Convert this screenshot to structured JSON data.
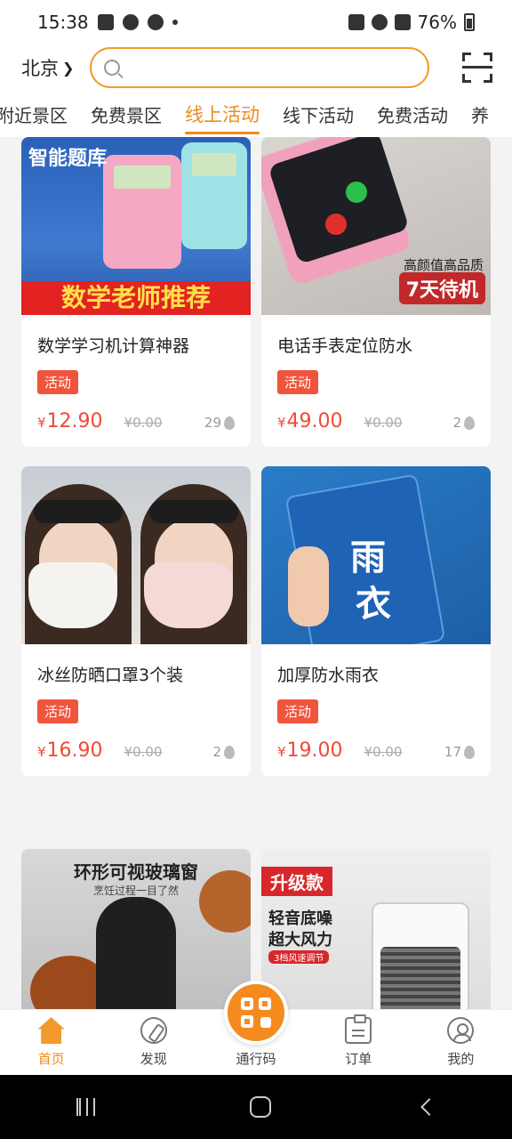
{
  "status_bar": {
    "time": "15:38",
    "battery": "76%"
  },
  "header": {
    "city": "北京",
    "search": {
      "placeholder": "",
      "value": ""
    }
  },
  "tabs": [
    {
      "label": "附近景区",
      "active": false
    },
    {
      "label": "免费景区",
      "active": false
    },
    {
      "label": "线上活动",
      "active": true
    },
    {
      "label": "线下活动",
      "active": false
    },
    {
      "label": "免费活动",
      "active": false
    },
    {
      "label": "养",
      "active": false
    }
  ],
  "products": [
    {
      "name": "数学学习机计算神器",
      "tag": "活动",
      "currency": "¥",
      "price": "12.90",
      "old_price": "¥0.00",
      "hot": "29",
      "image": {
        "title": "智能题库",
        "banner": "数学老师推荐"
      }
    },
    {
      "name": "电话手表定位防水",
      "tag": "活动",
      "currency": "¥",
      "price": "49.00",
      "old_price": "¥0.00",
      "hot": "2",
      "image": {
        "caption": "高颜值高品质",
        "banner": "7天待机"
      }
    },
    {
      "name": "冰丝防晒口罩3个装",
      "tag": "活动",
      "currency": "¥",
      "price": "16.90",
      "old_price": "¥0.00",
      "hot": "2",
      "image": {}
    },
    {
      "name": "加厚防水雨衣",
      "tag": "活动",
      "currency": "¥",
      "price": "19.00",
      "old_price": "¥0.00",
      "hot": "17",
      "image": {
        "text1": "雨",
        "text2": "衣"
      }
    },
    {
      "name": "",
      "tag": "",
      "currency": "",
      "price": "",
      "old_price": "",
      "hot": "",
      "image": {
        "title": "环形可视玻璃窗",
        "subtitle": "烹饪过程一目了然"
      }
    },
    {
      "name": "",
      "tag": "",
      "currency": "",
      "price": "",
      "old_price": "",
      "hot": "",
      "image": {
        "badge": "升级款",
        "line1": "轻音底噪",
        "line2": "超大风力",
        "line3": "3档风速调节"
      }
    }
  ],
  "bottom_nav": [
    {
      "label": "首页",
      "icon": "home-icon",
      "active": true
    },
    {
      "label": "发现",
      "icon": "compass-icon",
      "active": false
    },
    {
      "label": "通行码",
      "icon": "qr-code-icon",
      "active": false
    },
    {
      "label": "订单",
      "icon": "clipboard-icon",
      "active": false
    },
    {
      "label": "我的",
      "icon": "user-icon",
      "active": false
    }
  ],
  "colors": {
    "accent": "#f08a1c",
    "price": "#ee4b36",
    "tag": "#f0543c"
  }
}
